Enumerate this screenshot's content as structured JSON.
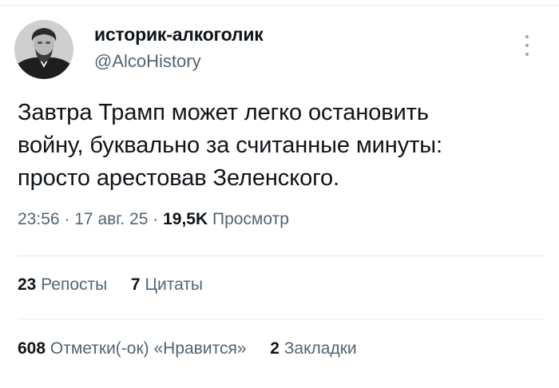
{
  "author": {
    "name": "историк-алкоголик",
    "handle": "@AlcoHistory"
  },
  "tweet": {
    "lines": [
      "Завтра Трамп  может легко остановить",
      "войну, буквально за считанные минуты:",
      "просто арестовав Зеленского."
    ]
  },
  "meta": {
    "time": "23:56",
    "date": "17 авг. 25",
    "separator": "·",
    "views_count": "19,5K",
    "views_label": "Просмотр"
  },
  "stats": {
    "reposts_count": "23",
    "reposts_label": "Репосты",
    "quotes_count": "7",
    "quotes_label": "Цитаты",
    "likes_count": "608",
    "likes_label": "Отметки(-ок) «Нравится»",
    "bookmarks_count": "2",
    "bookmarks_label": "Закладки"
  },
  "icons": {
    "more": "more-vertical-icon",
    "avatar": "avatar-portrait"
  },
  "colors": {
    "text": "#0f1419",
    "secondary": "#536471",
    "divider": "#e7e9ea"
  }
}
